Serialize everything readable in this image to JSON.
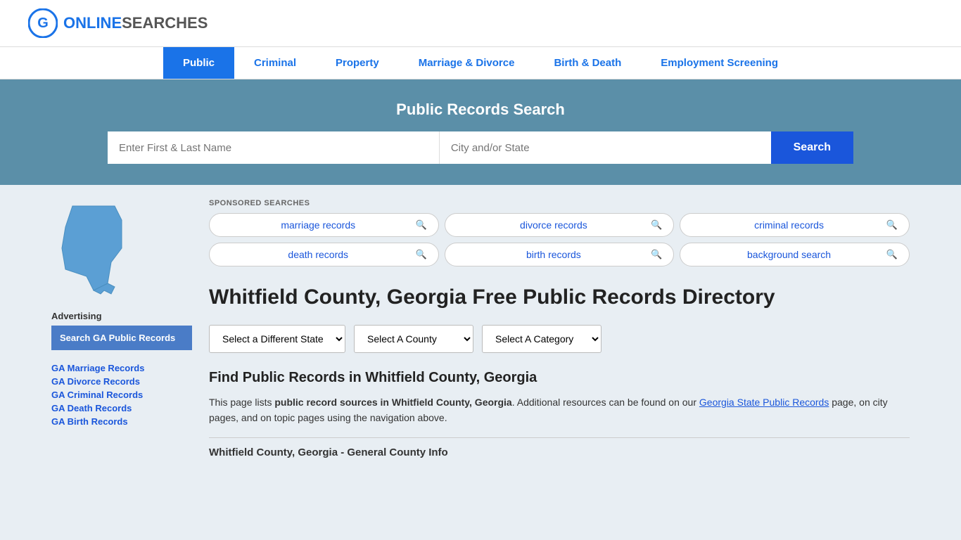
{
  "header": {
    "logo_text_bold": "ONLINE",
    "logo_text_light": "SEARCHES"
  },
  "nav": {
    "items": [
      {
        "label": "Public",
        "active": true
      },
      {
        "label": "Criminal",
        "active": false
      },
      {
        "label": "Property",
        "active": false
      },
      {
        "label": "Marriage & Divorce",
        "active": false
      },
      {
        "label": "Birth & Death",
        "active": false
      },
      {
        "label": "Employment Screening",
        "active": false
      }
    ]
  },
  "hero": {
    "title": "Public Records Search",
    "name_placeholder": "Enter First & Last Name",
    "location_placeholder": "City and/or State",
    "search_button": "Search"
  },
  "sponsored": {
    "label": "SPONSORED SEARCHES",
    "items": [
      "marriage records",
      "divorce records",
      "criminal records",
      "death records",
      "birth records",
      "background search"
    ]
  },
  "page": {
    "heading": "Whitfield County, Georgia Free Public Records Directory",
    "dropdown_state": "Select a Different State",
    "dropdown_county": "Select A County",
    "dropdown_category": "Select A Category",
    "find_title": "Find Public Records in Whitfield County, Georgia",
    "find_description_1": "This page lists ",
    "find_description_bold": "public record sources in Whitfield County, Georgia",
    "find_description_2": ". Additional resources can be found on our ",
    "find_link_text": "Georgia State Public Records",
    "find_description_3": " page, on city pages, and on topic pages using the navigation above.",
    "county_info_label": "Whitfield County, Georgia - General County Info"
  },
  "sidebar": {
    "map_alt": "Georgia state map",
    "advertising_label": "Advertising",
    "ad_box_text": "Search GA Public Records",
    "links": [
      "GA Marriage Records",
      "GA Divorce Records",
      "GA Criminal Records",
      "GA Death Records",
      "GA Birth Records"
    ]
  }
}
